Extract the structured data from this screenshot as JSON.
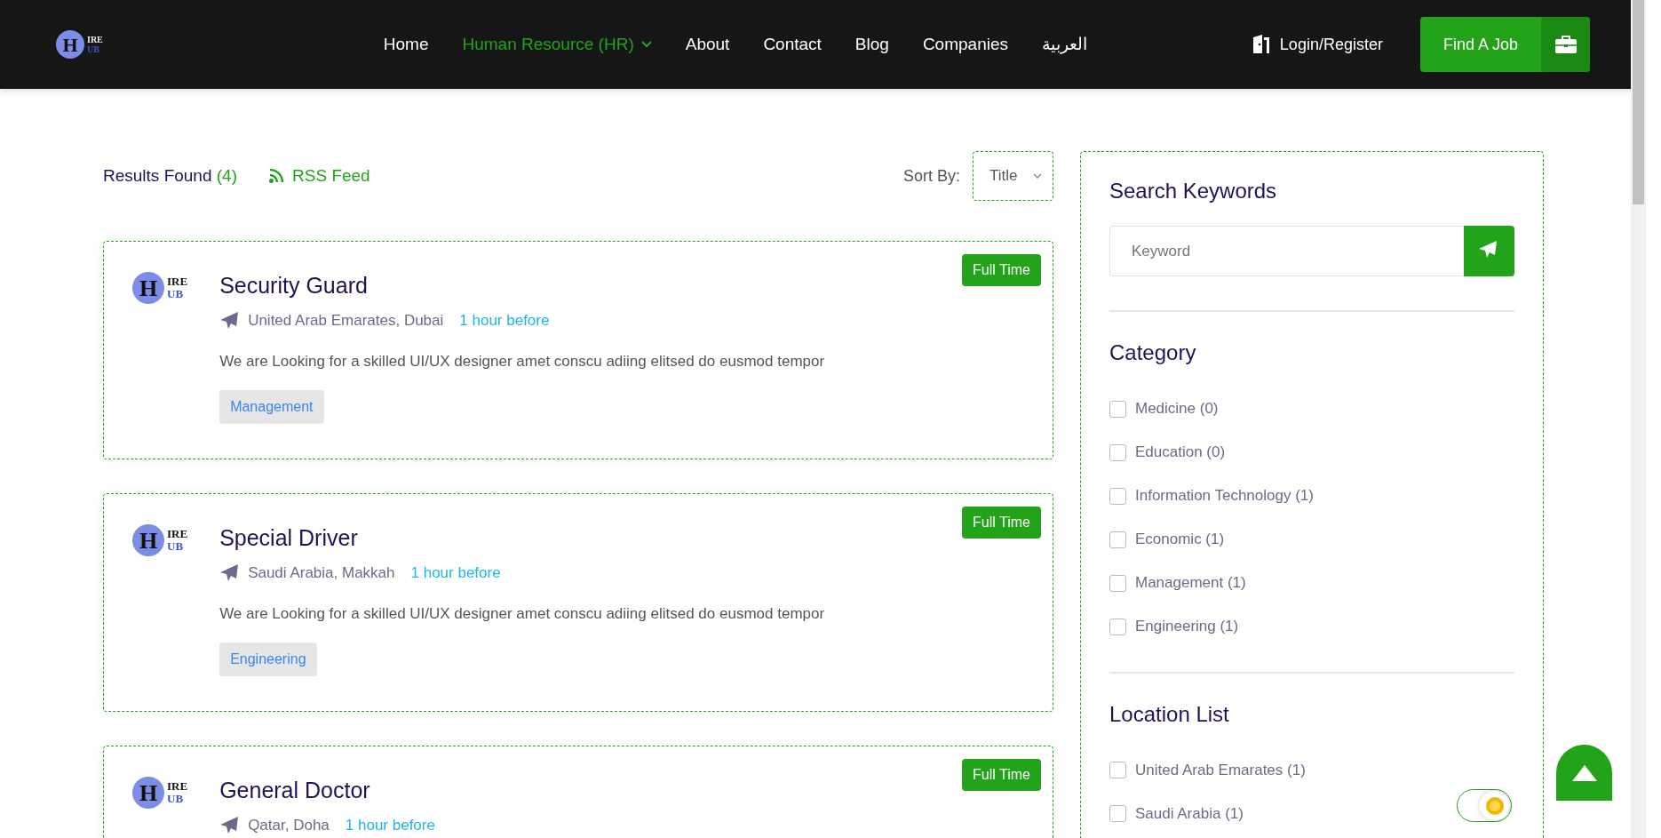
{
  "header": {
    "logo": {
      "letter": "H",
      "top": "IRE",
      "bottom": "UB"
    },
    "nav": [
      {
        "label": "Home",
        "selected": false,
        "dropdown": false
      },
      {
        "label": "Human Resource (HR)",
        "selected": true,
        "dropdown": true
      },
      {
        "label": "About",
        "selected": false,
        "dropdown": false
      },
      {
        "label": "Contact",
        "selected": false,
        "dropdown": false
      },
      {
        "label": "Blog",
        "selected": false,
        "dropdown": false
      },
      {
        "label": "Companies",
        "selected": false,
        "dropdown": false
      },
      {
        "label": "العربية",
        "selected": false,
        "dropdown": false
      }
    ],
    "login": "Login/Register",
    "cta": "Find A Job"
  },
  "results": {
    "label": "Results Found",
    "count": "(4)",
    "rss": "RSS Feed",
    "sort_label": "Sort By:",
    "sort_value": "Title"
  },
  "jobs": [
    {
      "logo": {
        "letter": "H",
        "top": "IRE",
        "bottom": "UB"
      },
      "title": "Security Guard",
      "location": "United Arab Emarates, Dubai",
      "time": "1 hour before",
      "description": "We are Looking for a skilled UI/UX designer amet conscu adiing elitsed do eusmod tempor",
      "tag": "Management",
      "type": "Full Time"
    },
    {
      "logo": {
        "letter": "H",
        "top": "IRE",
        "bottom": "UB"
      },
      "title": "Special Driver",
      "location": "Saudi Arabia, Makkah",
      "time": "1 hour before",
      "description": "We are Looking for a skilled UI/UX designer amet conscu adiing elitsed do eusmod tempor",
      "tag": "Engineering",
      "type": "Full Time"
    },
    {
      "logo": {
        "letter": "H",
        "top": "IRE",
        "bottom": "UB"
      },
      "title": "General Doctor",
      "location": "Qatar, Doha",
      "time": "1 hour before",
      "type": "Full Time"
    }
  ],
  "sidebar": {
    "search": {
      "title": "Search Keywords",
      "placeholder": "Keyword"
    },
    "category": {
      "title": "Category",
      "items": [
        {
          "label": "Medicine (0)",
          "checked": false
        },
        {
          "label": "Education (0)",
          "checked": false
        },
        {
          "label": "Information Technology (1)",
          "checked": false
        },
        {
          "label": "Economic (1)",
          "checked": false
        },
        {
          "label": "Management (1)",
          "checked": false
        },
        {
          "label": "Engineering (1)",
          "checked": false
        }
      ]
    },
    "location": {
      "title": "Location List",
      "items": [
        {
          "label": "United Arab Emarates (1)",
          "checked": false
        },
        {
          "label": "Saudi Arabia (1)",
          "checked": false
        }
      ]
    }
  },
  "theme_toggle": {
    "on": true
  }
}
